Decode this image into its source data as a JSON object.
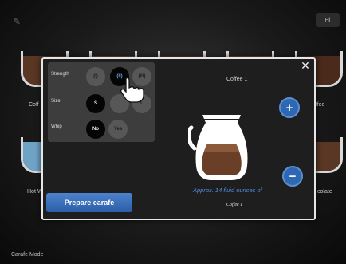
{
  "top_bar": {
    "app_icon": "tools-icon",
    "language_button": "Hi"
  },
  "background_items": [
    {
      "label": "Coff",
      "fill": "#5a3624"
    },
    {
      "label": "",
      "fill": "#6b4530"
    },
    {
      "label": "",
      "fill": "#5a3624"
    },
    {
      "label": "",
      "fill": "#6b4530"
    },
    {
      "label": "",
      "fill": "#5a3624"
    },
    {
      "label": "offee",
      "fill": "#4a2a1a"
    },
    {
      "label": "Hot W",
      "fill": "#6fa3c6"
    },
    {
      "label": "colate",
      "fill": "#5a3624"
    }
  ],
  "mode_label": "Carafe Mode",
  "modal": {
    "close_icon": "close-icon",
    "product_title": "Coffee 1",
    "options": {
      "strength": {
        "label": "Strength",
        "values": [
          "(I)",
          "(II)",
          "(III)"
        ],
        "selected": "(II)"
      },
      "size": {
        "label": "Size",
        "values": [
          "S",
          "",
          "L"
        ],
        "selected": "S"
      },
      "whip": {
        "label": "Whip",
        "values": [
          "No",
          "Yes"
        ],
        "selected": "No"
      }
    },
    "plus_label": "+",
    "minus_label": "−",
    "amount_text": "Approx. 14 fluid ounces of",
    "amount_product": "Coffee 1",
    "prepare_button": "Prepare carafe",
    "colors": {
      "accent": "#2f68b2",
      "text_blue": "#4f8de0",
      "panel": "#3d3d3d"
    }
  }
}
